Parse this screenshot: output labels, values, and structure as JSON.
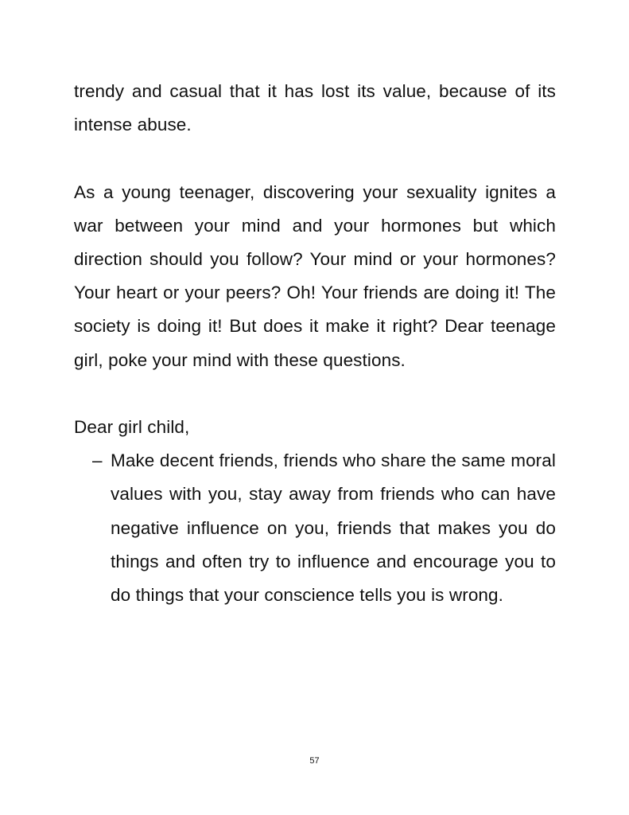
{
  "paragraphs": {
    "p1": "trendy and casual that it has lost its value, because of its intense abuse.",
    "p2": "As a young teenager, discovering your sexuality ignites a war between your mind and your hormones but which direction should you follow? Your mind or your hormones? Your heart or your peers? Oh! Your friends are doing it! The society is doing it! But does it make it right? Dear teenage girl, poke your mind with these questions.",
    "salutation": "Dear girl child,"
  },
  "list": {
    "items": [
      {
        "marker": "–",
        "text": "Make decent friends, friends who share the same moral values with you, stay away from friends who can have negative influence on you, friends that makes you do things and often try to influence and encourage you to do things that your conscience tells you is wrong."
      }
    ]
  },
  "footer": {
    "page_number": "57"
  }
}
